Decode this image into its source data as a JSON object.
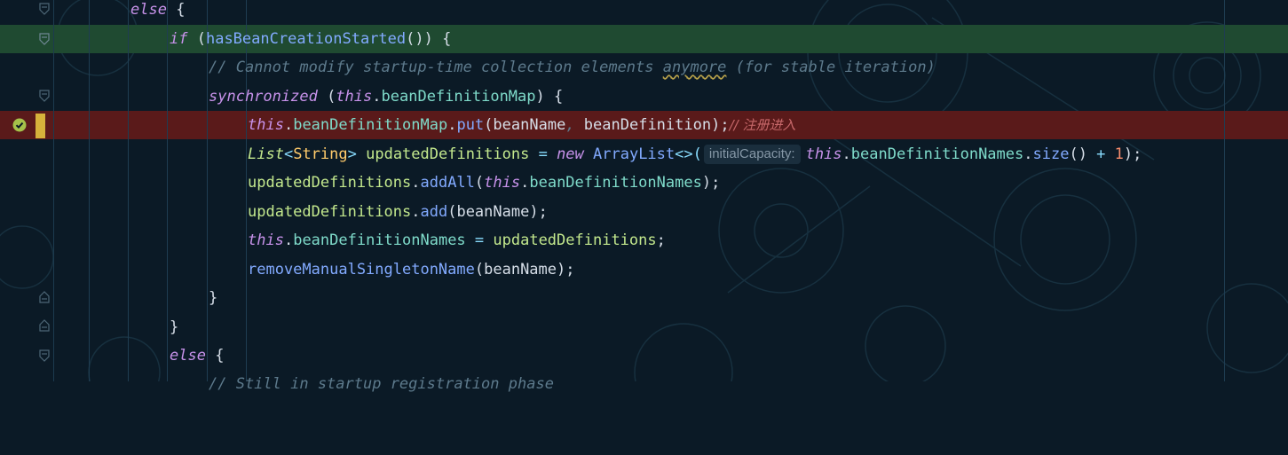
{
  "editor": {
    "lines": {
      "l1": {
        "else": "else",
        "brace": " {"
      },
      "l2": {
        "if": "if",
        "open": " (",
        "call": "hasBeanCreationStarted",
        "rest": "()) {"
      },
      "l3": {
        "comment_a": "// Cannot modify startup-time collection elements ",
        "comment_word": "anymore",
        "comment_b": " (for stable iteration)"
      },
      "l4": {
        "sync": "synchronized",
        "open": " (",
        "this": "this",
        "dot": ".",
        "field": "beanDefinitionMap",
        "close": ") {"
      },
      "l5": {
        "this": "this",
        "dot": ".",
        "field": "beanDefinitionMap",
        "dot2": ".",
        "method": "put",
        "open": "(",
        "arg1": "beanName",
        "comma": ", ",
        "arg2": "beanDefinition",
        "close": ");",
        "comment": "// 注册进入"
      },
      "l6": {
        "type": "List",
        "lt": "<",
        "generic": "String",
        "gt": ">",
        "var": " updatedDefinitions",
        "eq": " = ",
        "new": "new",
        "cls": " ArrayList",
        "diamond": "<>(",
        "hint": "initialCapacity:",
        "this": "this",
        "dot": ".",
        "field": "beanDefinitionNames",
        "dot2": ".",
        "method": "size",
        "paren": "()",
        "plus": " + ",
        "num": "1",
        "end": ");"
      },
      "l7": {
        "var": "updatedDefinitions",
        "dot": ".",
        "method": "addAll",
        "open": "(",
        "this": "this",
        "dot2": ".",
        "field": "beanDefinitionNames",
        "close": ");"
      },
      "l8": {
        "var": "updatedDefinitions",
        "dot": ".",
        "method": "add",
        "open": "(",
        "arg": "beanName",
        "close": ");"
      },
      "l9": {
        "this": "this",
        "dot": ".",
        "field": "beanDefinitionNames",
        "eq": " = ",
        "var": "updatedDefinitions",
        "end": ";"
      },
      "l10": {
        "method": "removeManualSingletonName",
        "open": "(",
        "arg": "beanName",
        "close": ");"
      },
      "l11": {
        "brace": "}"
      },
      "l12": {
        "brace": "}"
      },
      "l13": {
        "else": "else",
        "brace": " {"
      },
      "l14": {
        "comment": "// Still in startup registration phase"
      }
    }
  },
  "colors": {
    "background": "#0b1a26",
    "keyword": "#c792ea",
    "function": "#82aaff",
    "field": "#7fdbca",
    "variable": "#c3e88d",
    "type": "#ffcb6b",
    "comment": "#5d7a8c",
    "number": "#f78c6c",
    "highlight_green": "#1f4a31",
    "highlight_red": "#5a1a1a",
    "breakpoint_marker": "#d6b23b"
  },
  "icons": {
    "fold": "fold-marker-icon",
    "breakpoint": "breakpoint-check-icon"
  }
}
